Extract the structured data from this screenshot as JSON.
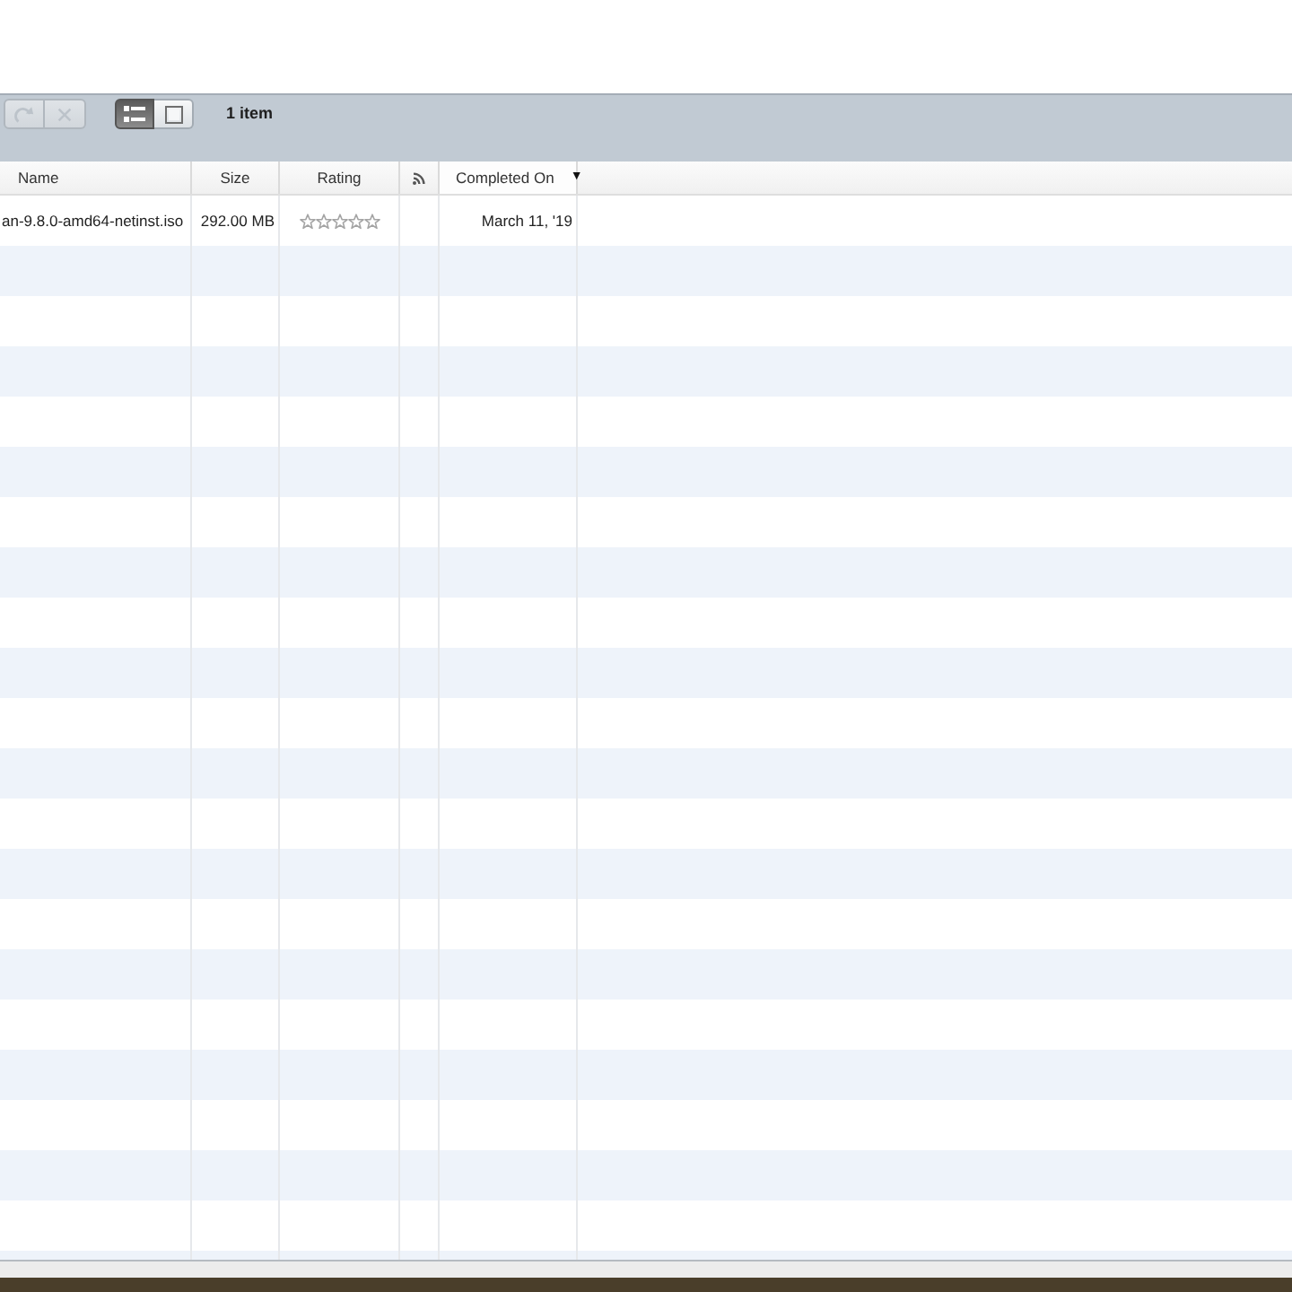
{
  "toolbar": {
    "buttons": [
      {
        "kind": "arrow",
        "disabled": true
      },
      {
        "kind": "cross",
        "disabled": true
      }
    ],
    "view_modes": [
      {
        "kind": "list",
        "selected": true
      },
      {
        "kind": "pane",
        "selected": false
      }
    ],
    "item_count": "1 item"
  },
  "table": {
    "columns": [
      {
        "kind": "name",
        "label": "Name",
        "sorted": false
      },
      {
        "kind": "size",
        "label": "Size",
        "sorted": false
      },
      {
        "kind": "rating",
        "label": "Rating",
        "sorted": false
      },
      {
        "kind": "feed",
        "sorted": false
      },
      {
        "kind": "date",
        "label": "Completed On",
        "sorted": true,
        "sort_arrow": "▼"
      }
    ],
    "rows": [
      {
        "name": "an-9.8.0-amd64-netinst.iso",
        "size": "292.00 MB",
        "stars": 0,
        "completed_on": "March 11, '19"
      }
    ]
  }
}
